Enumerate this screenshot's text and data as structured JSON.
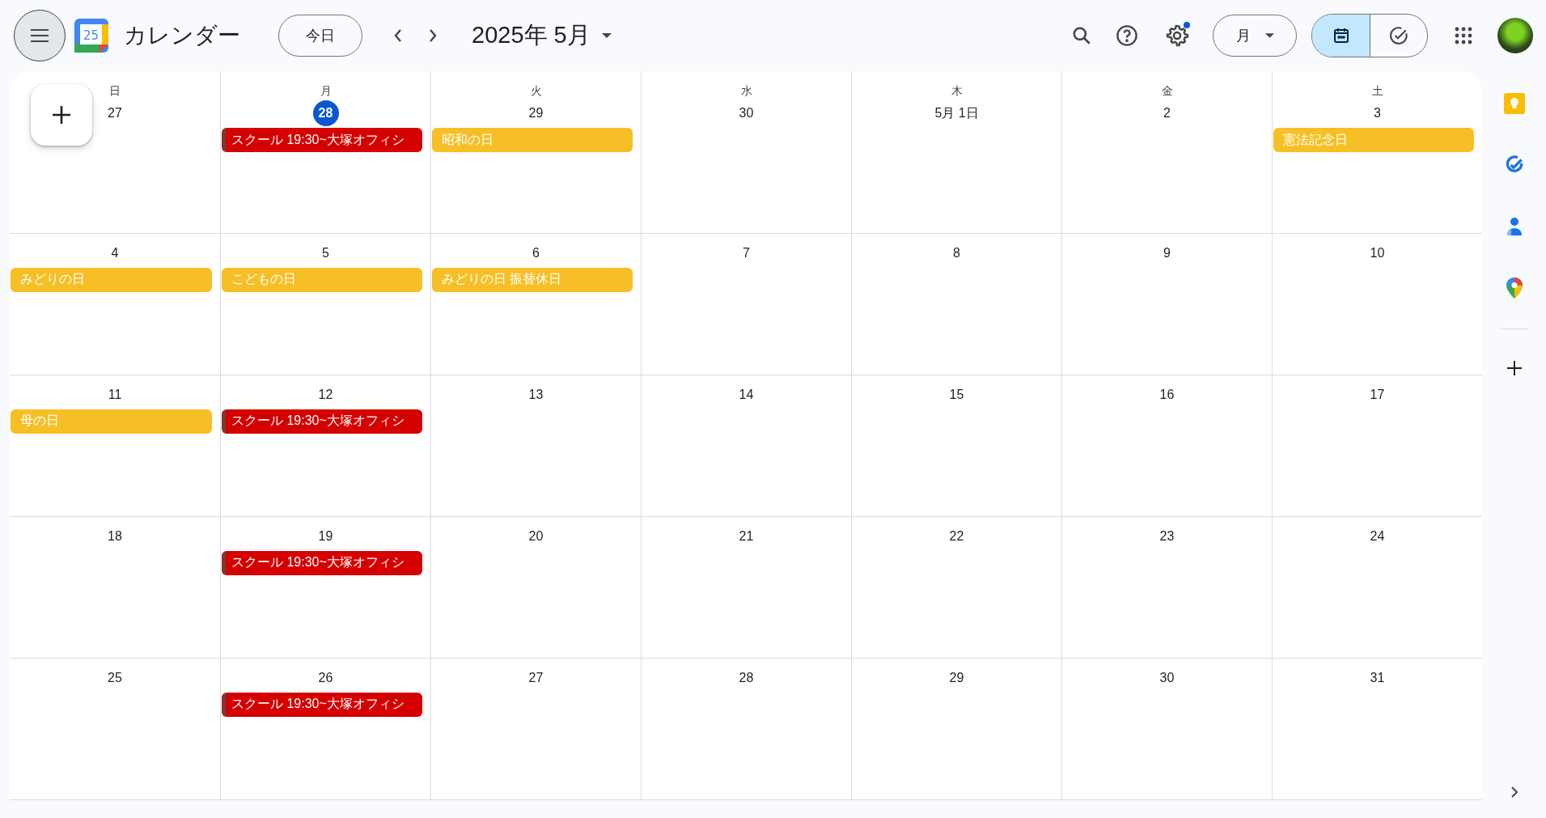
{
  "header": {
    "logo_text": "25",
    "app_title": "カレンダー",
    "today_button": "今日",
    "period": "2025年 5月",
    "view_selector": "月",
    "settings_notification": true,
    "view_toggle": [
      {
        "kind": "calendar",
        "selected": true
      },
      {
        "kind": "tasks",
        "selected": false
      }
    ]
  },
  "weekdays": [
    "日",
    "月",
    "火",
    "水",
    "木",
    "金",
    "土"
  ],
  "weeks": [
    [
      {
        "date": "27",
        "today": false
      },
      {
        "date": "28",
        "today": true,
        "events": [
          {
            "title": "スクール 19:30~大塚オフィシ",
            "color": "#d50000",
            "stripe": true
          }
        ]
      },
      {
        "date": "29",
        "today": false,
        "events": [
          {
            "title": "昭和の日",
            "color": "#f6bf26",
            "stripe": false
          }
        ]
      },
      {
        "date": "30",
        "today": false
      },
      {
        "date": "5月 1日",
        "today": false
      },
      {
        "date": "2",
        "today": false
      },
      {
        "date": "3",
        "today": false,
        "events": [
          {
            "title": "憲法記念日",
            "color": "#f6bf26",
            "stripe": false
          }
        ]
      }
    ],
    [
      {
        "date": "4",
        "today": false,
        "events": [
          {
            "title": "みどりの日",
            "color": "#f6bf26",
            "stripe": false
          }
        ]
      },
      {
        "date": "5",
        "today": false,
        "events": [
          {
            "title": "こどもの日",
            "color": "#f6bf26",
            "stripe": false
          }
        ]
      },
      {
        "date": "6",
        "today": false,
        "events": [
          {
            "title": "みどりの日 振替休日",
            "color": "#f6bf26",
            "stripe": false
          }
        ]
      },
      {
        "date": "7",
        "today": false
      },
      {
        "date": "8",
        "today": false
      },
      {
        "date": "9",
        "today": false
      },
      {
        "date": "10",
        "today": false
      }
    ],
    [
      {
        "date": "11",
        "today": false,
        "events": [
          {
            "title": "母の日",
            "color": "#f6bf26",
            "stripe": false
          }
        ]
      },
      {
        "date": "12",
        "today": false,
        "events": [
          {
            "title": "スクール 19:30~大塚オフィシ",
            "color": "#d50000",
            "stripe": true
          }
        ]
      },
      {
        "date": "13",
        "today": false
      },
      {
        "date": "14",
        "today": false
      },
      {
        "date": "15",
        "today": false
      },
      {
        "date": "16",
        "today": false
      },
      {
        "date": "17",
        "today": false
      }
    ],
    [
      {
        "date": "18",
        "today": false
      },
      {
        "date": "19",
        "today": false,
        "events": [
          {
            "title": "スクール 19:30~大塚オフィシ",
            "color": "#d50000",
            "stripe": true
          }
        ]
      },
      {
        "date": "20",
        "today": false
      },
      {
        "date": "21",
        "today": false
      },
      {
        "date": "22",
        "today": false
      },
      {
        "date": "23",
        "today": false
      },
      {
        "date": "24",
        "today": false
      }
    ],
    [
      {
        "date": "25",
        "today": false
      },
      {
        "date": "26",
        "today": false,
        "events": [
          {
            "title": "スクール 19:30~大塚オフィシ",
            "color": "#d50000",
            "stripe": true
          }
        ]
      },
      {
        "date": "27",
        "today": false
      },
      {
        "date": "28",
        "today": false
      },
      {
        "date": "29",
        "today": false
      },
      {
        "date": "30",
        "today": false
      },
      {
        "date": "31",
        "today": false
      }
    ]
  ]
}
